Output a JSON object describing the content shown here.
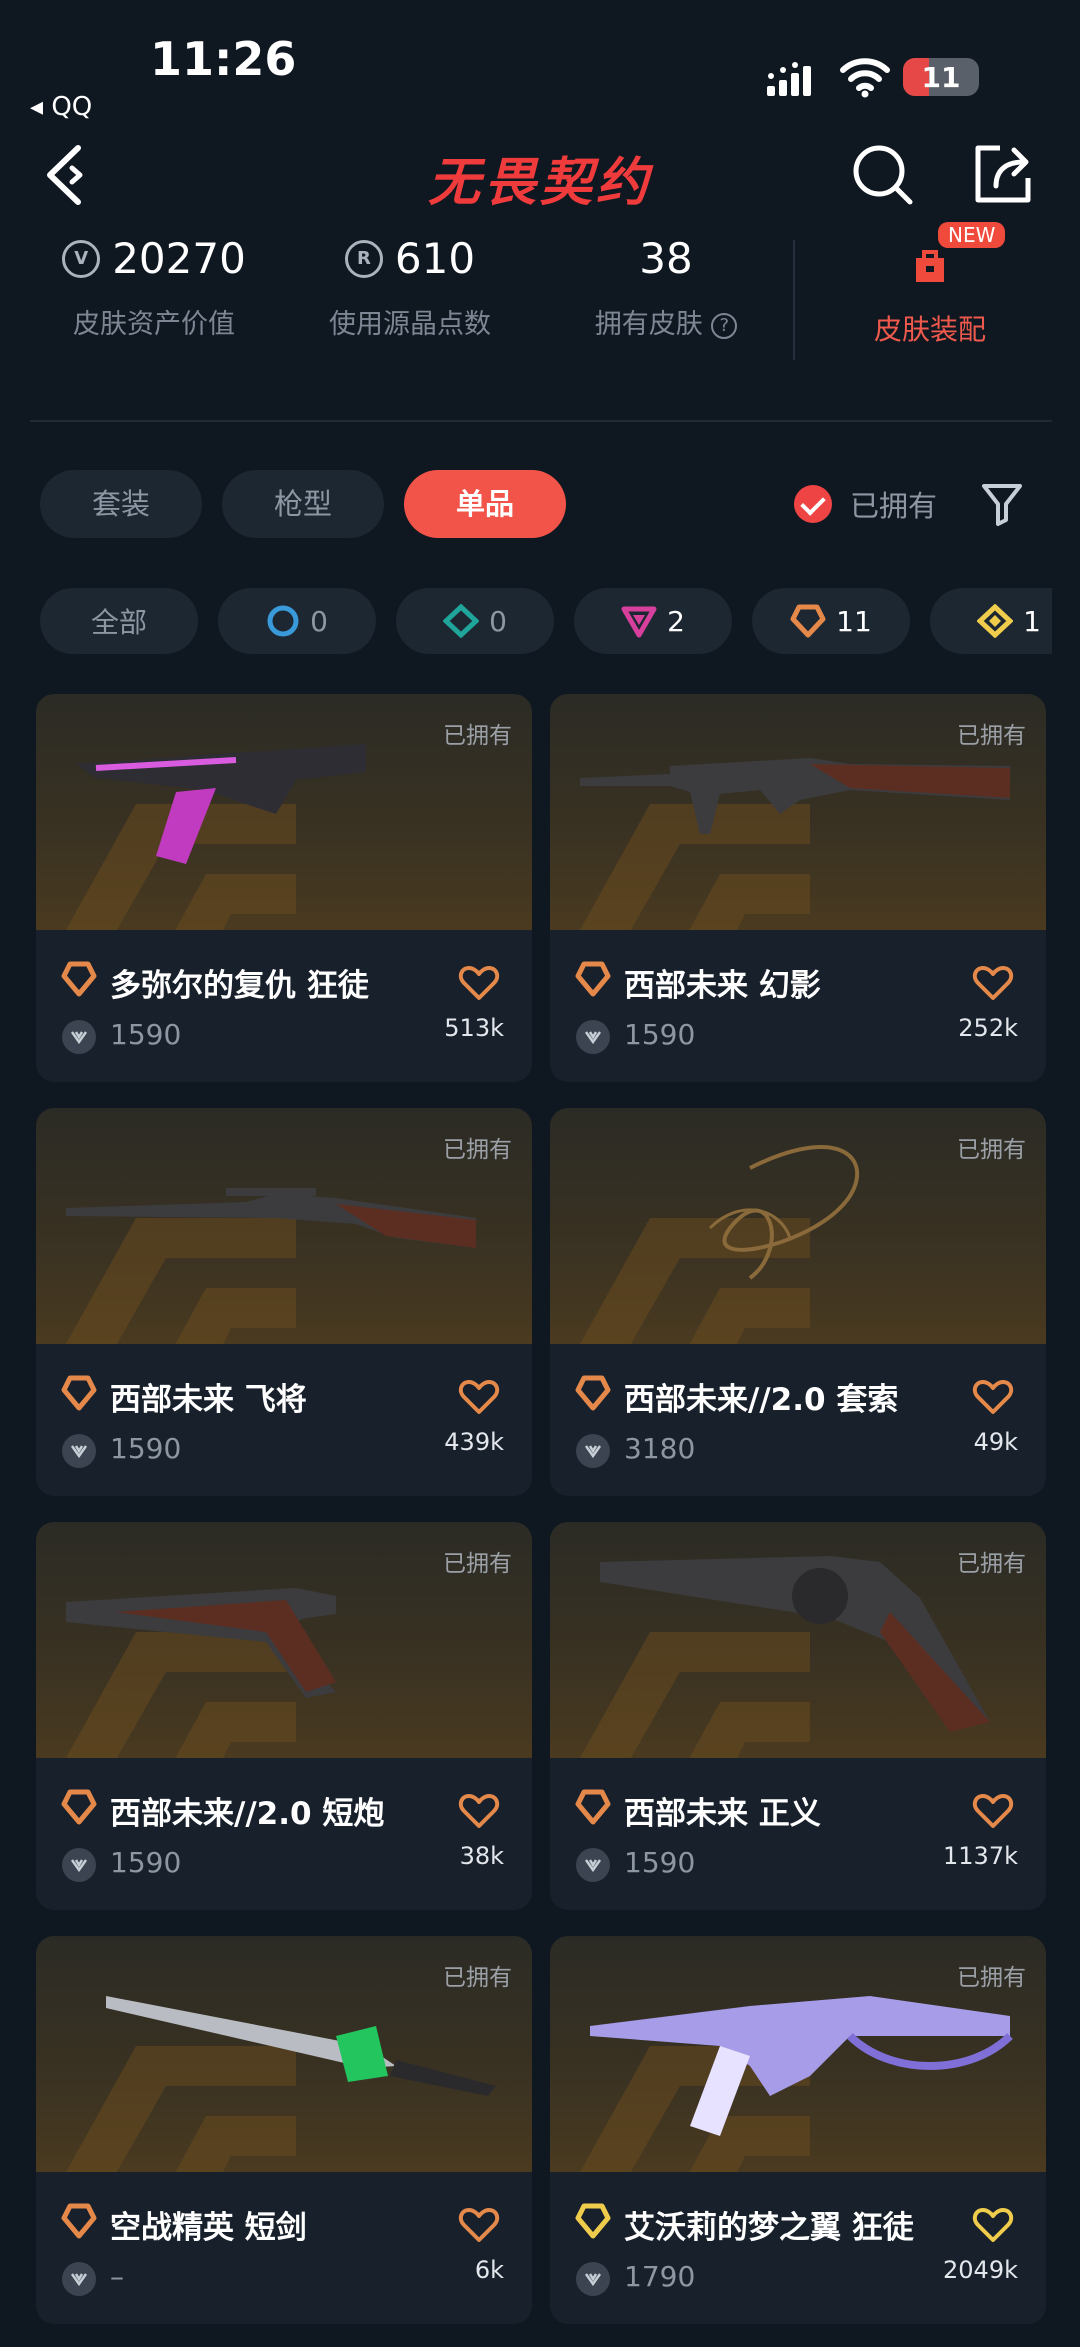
{
  "status": {
    "time": "11:26",
    "back_app": "◂ QQ",
    "battery": "11"
  },
  "header": {
    "logo": "无畏契约"
  },
  "stats": [
    {
      "value": "20270",
      "label": "皮肤资产价值",
      "icon": "valorant-points-icon"
    },
    {
      "value": "610",
      "label": "使用源晶点数",
      "icon": "radianite-icon"
    },
    {
      "value": "38",
      "label": "拥有皮肤",
      "icon": "help-icon"
    }
  ],
  "outfit": {
    "label": "皮肤装配",
    "badge": "NEW"
  },
  "tabs": [
    {
      "label": "套装",
      "active": false
    },
    {
      "label": "枪型",
      "active": false
    },
    {
      "label": "单品",
      "active": true
    }
  ],
  "owned_filter": {
    "label": "已拥有",
    "checked": true
  },
  "chips": [
    {
      "label": "全部",
      "count": ""
    },
    {
      "tier": "select-blue",
      "count": "0",
      "color": "#3a9ad9"
    },
    {
      "tier": "deluxe-teal",
      "count": "0",
      "color": "#1fa59a"
    },
    {
      "tier": "premium-pink",
      "count": "2",
      "color": "#d6409c"
    },
    {
      "tier": "exclusive-orange",
      "count": "11",
      "color": "#e5894a"
    },
    {
      "tier": "ultra-gold",
      "count": "1",
      "color": "#f0cc4c"
    }
  ],
  "cards": [
    {
      "owned": "已拥有",
      "name": "多弥尔的复仇 狂徒",
      "price": "1590",
      "likes": "513k",
      "tier_color": "#e5894a"
    },
    {
      "owned": "已拥有",
      "name": "西部未来 幻影",
      "price": "1590",
      "likes": "252k",
      "tier_color": "#e5894a"
    },
    {
      "owned": "已拥有",
      "name": "西部未来 飞将",
      "price": "1590",
      "likes": "439k",
      "tier_color": "#e5894a"
    },
    {
      "owned": "已拥有",
      "name": "西部未来//2.0 套索",
      "price": "3180",
      "likes": "49k",
      "tier_color": "#e5894a"
    },
    {
      "owned": "已拥有",
      "name": "西部未来//2.0 短炮",
      "price": "1590",
      "likes": "38k",
      "tier_color": "#e5894a"
    },
    {
      "owned": "已拥有",
      "name": "西部未来 正义",
      "price": "1590",
      "likes": "1137k",
      "tier_color": "#e5894a"
    },
    {
      "owned": "已拥有",
      "name": "空战精英 短剑",
      "price": "–",
      "likes": "6k",
      "tier_color": "#e5894a"
    },
    {
      "owned": "已拥有",
      "name": "艾沃莉的梦之翼 狂徒",
      "price": "1790",
      "likes": "2049k",
      "tier_color": "#f0cc4c"
    }
  ]
}
